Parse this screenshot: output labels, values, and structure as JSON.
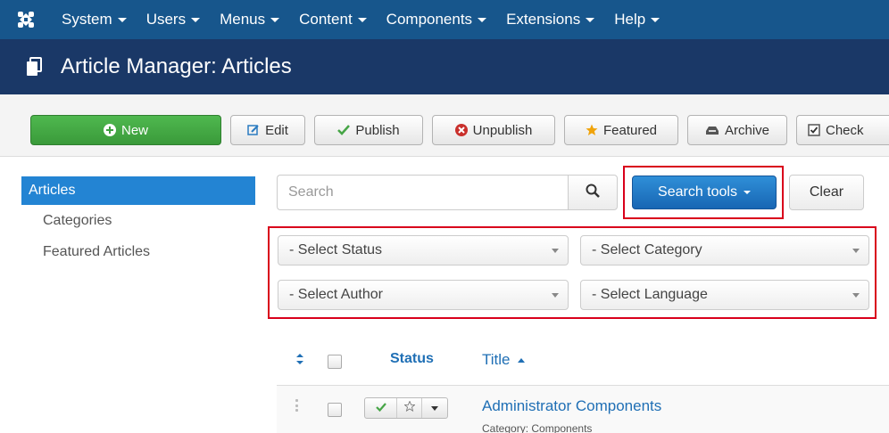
{
  "menubar": {
    "items": [
      {
        "label": "System"
      },
      {
        "label": "Users"
      },
      {
        "label": "Menus"
      },
      {
        "label": "Content"
      },
      {
        "label": "Components"
      },
      {
        "label": "Extensions"
      },
      {
        "label": "Help"
      }
    ],
    "bg": "#17568c"
  },
  "titlebar": {
    "title": "Article Manager: Articles",
    "bg": "#1a3867"
  },
  "toolbar": {
    "new_label": "New",
    "edit_label": "Edit",
    "publish_label": "Publish",
    "unpublish_label": "Unpublish",
    "featured_label": "Featured",
    "archive_label": "Archive",
    "checkin_label": "Check"
  },
  "sidebar": {
    "items": [
      {
        "label": "Articles",
        "active": true
      },
      {
        "label": "Categories"
      },
      {
        "label": "Featured Articles"
      }
    ]
  },
  "search": {
    "placeholder": "Search",
    "tools_label": "Search tools",
    "clear_label": "Clear"
  },
  "filters": {
    "status": "- Select Status",
    "category": "- Select Category",
    "author": "- Select Author",
    "language": "- Select Language"
  },
  "table": {
    "headers": {
      "status": "Status",
      "title": "Title"
    },
    "rows": [
      {
        "title": "Administrator Components",
        "category": "Category: Components"
      }
    ]
  },
  "colors": {
    "accent": "#2384d3",
    "highlight": "#d9001b",
    "new_button": "#46a546",
    "link": "#1f6fb5"
  }
}
